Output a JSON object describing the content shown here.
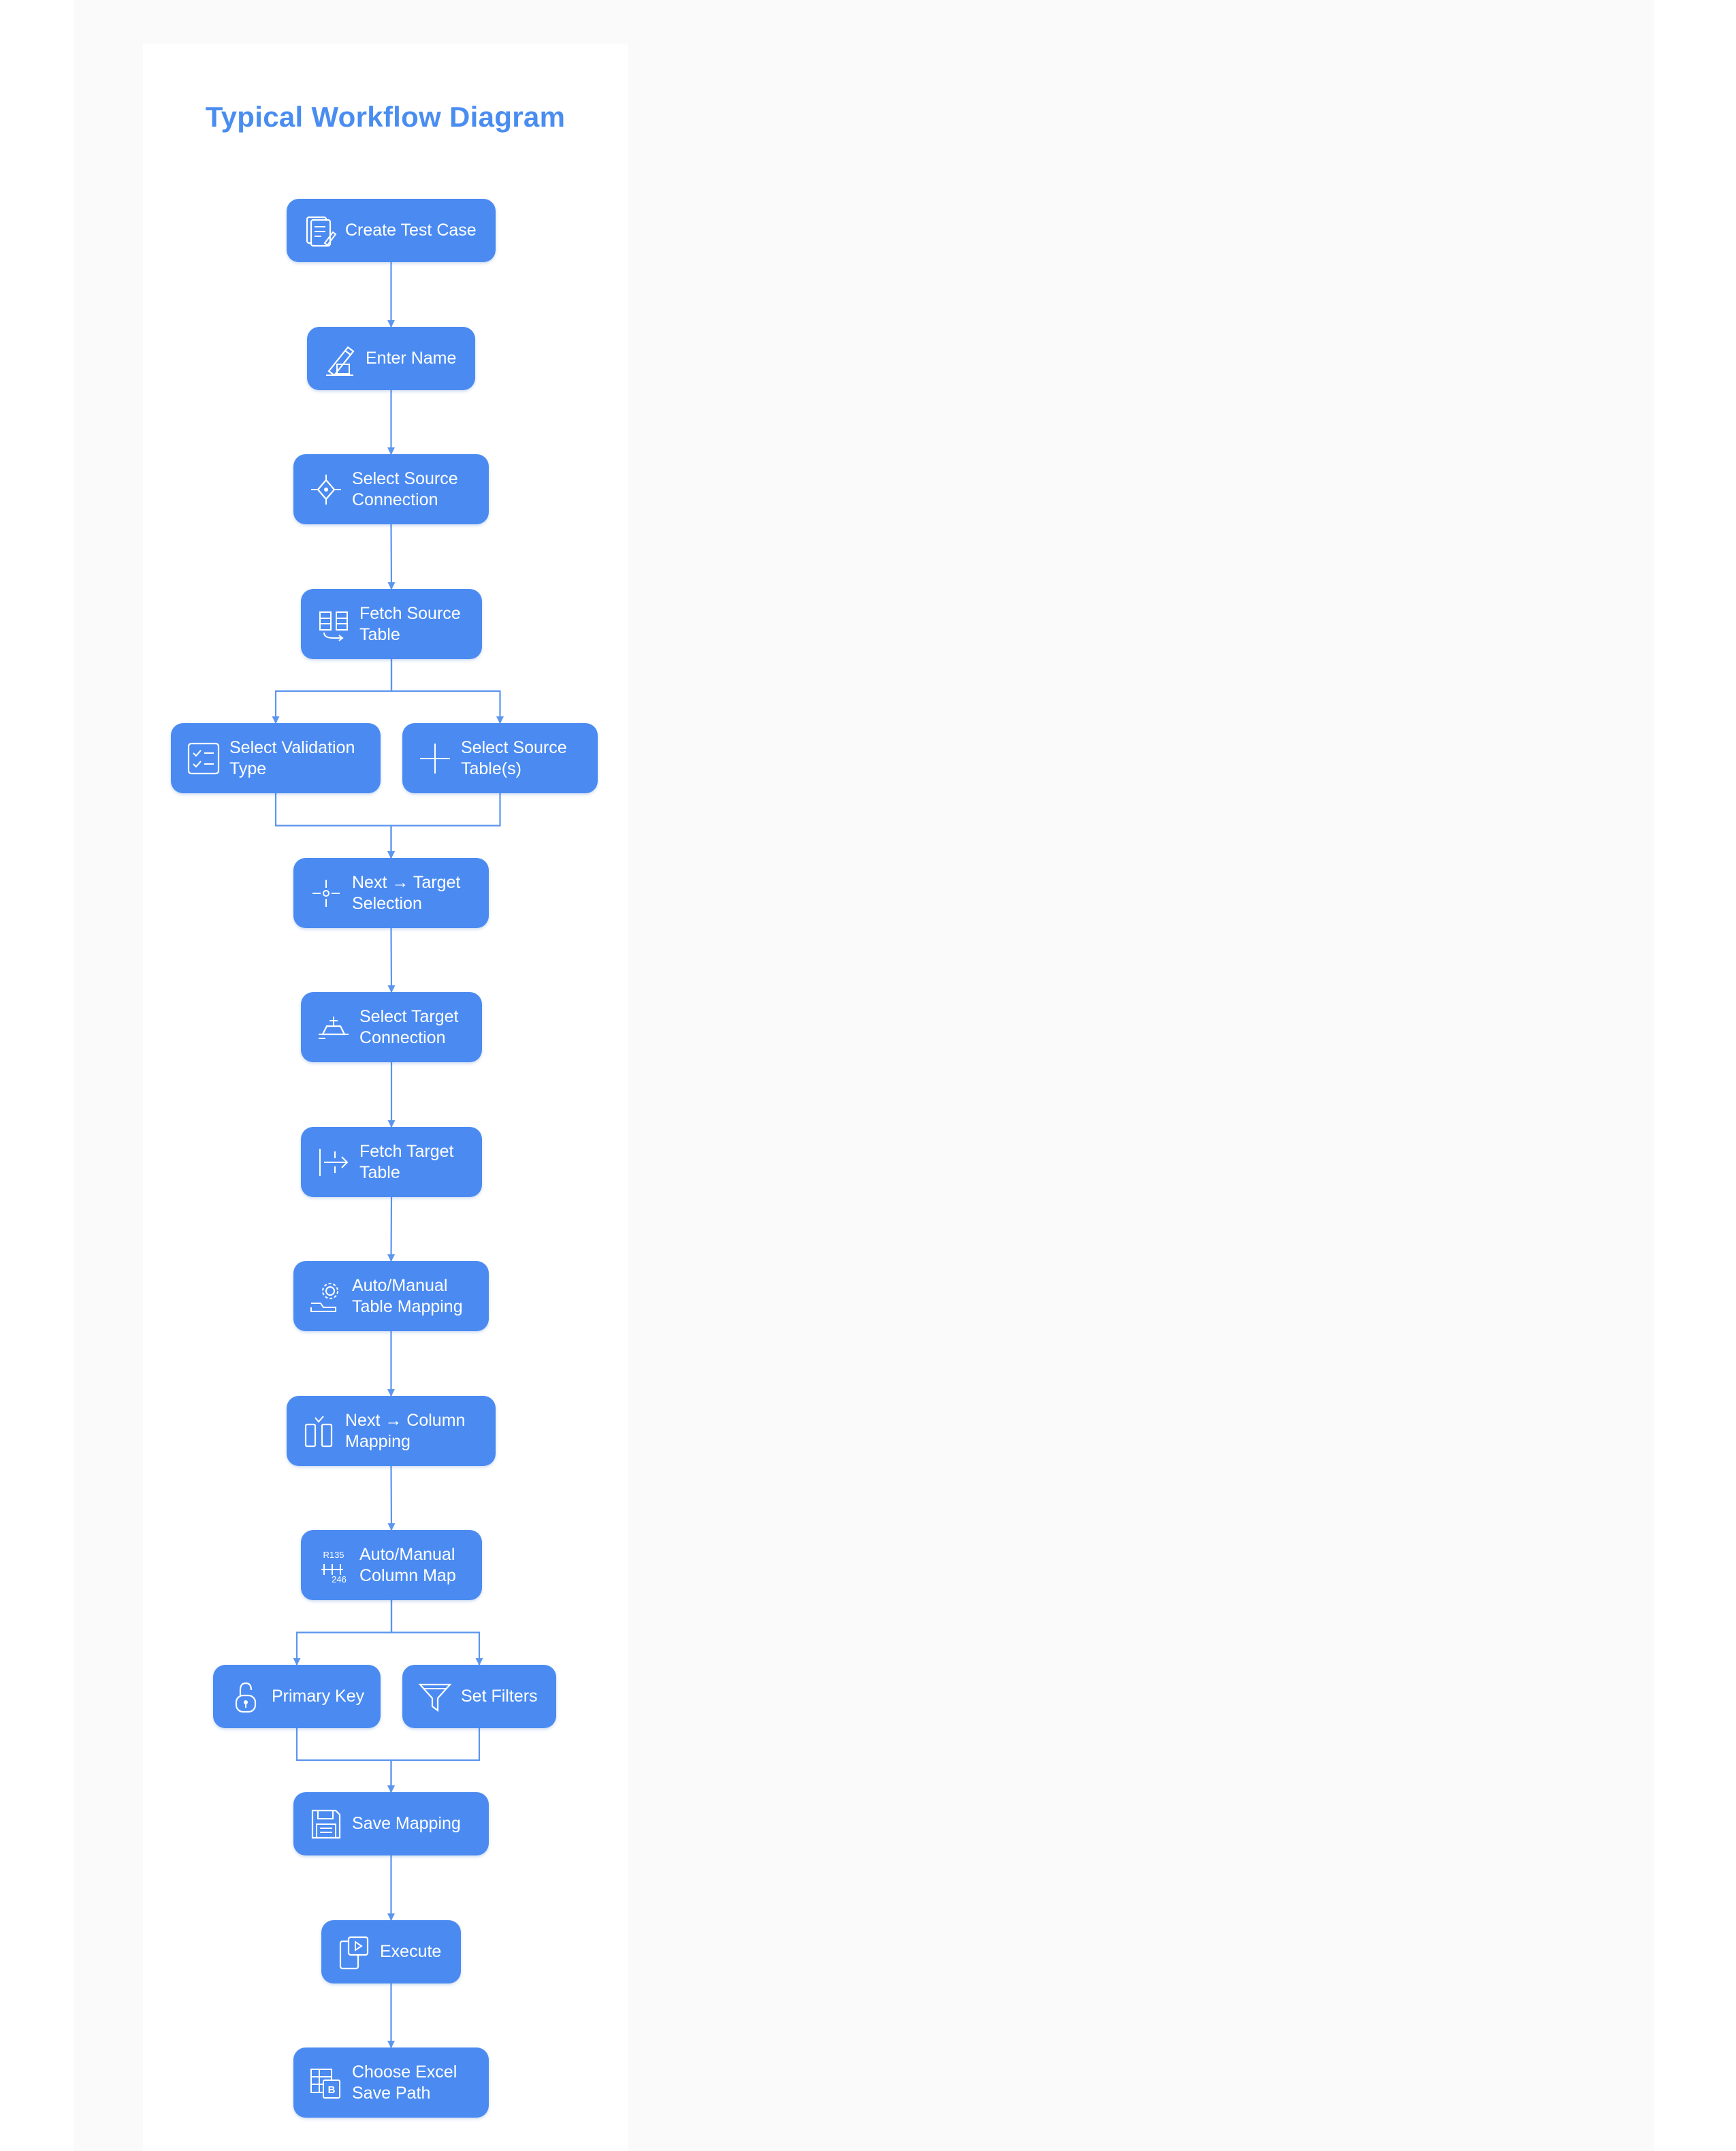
{
  "diagram": {
    "title": "Typical Workflow Diagram",
    "colors": {
      "node_fill": "#4b8bf1",
      "connector": "#5b95ee",
      "title": "#4a8df0",
      "text": "#ffffff"
    },
    "nodes": [
      {
        "id": "create_test_case",
        "label": "Create Test Case",
        "icon": "test-case-icon"
      },
      {
        "id": "enter_name",
        "label": "Enter Name",
        "icon": "pen-icon"
      },
      {
        "id": "select_source_connection",
        "label": "Select Source Connection",
        "icon": "connection-icon"
      },
      {
        "id": "fetch_source_table",
        "label": "Fetch Source Table",
        "icon": "table-fetch-icon"
      },
      {
        "id": "select_validation_type",
        "label": "Select Validation Type",
        "icon": "checklist-icon"
      },
      {
        "id": "select_source_tables",
        "label": "Select Source Table(s)",
        "icon": "plus-icon"
      },
      {
        "id": "next_target_selection",
        "label": "Next → Target Selection",
        "icon": "crosshair-icon"
      },
      {
        "id": "select_target_connection",
        "label": "Select Target Connection",
        "icon": "target-connection-icon"
      },
      {
        "id": "fetch_target_table",
        "label": "Fetch Target Table",
        "icon": "arrow-right-icon"
      },
      {
        "id": "auto_manual_table_mapping",
        "label": "Auto/Manual Table Mapping",
        "icon": "gear-icon"
      },
      {
        "id": "next_column_mapping",
        "label": "Next → Column Mapping",
        "icon": "columns-icon"
      },
      {
        "id": "auto_manual_column_map",
        "label": "Auto/Manual Column Map",
        "icon": "gear-shift-icon",
        "icon_text": [
          "R135",
          "246"
        ]
      },
      {
        "id": "primary_key",
        "label": "Primary Key",
        "icon": "lock-icon"
      },
      {
        "id": "set_filters",
        "label": "Set Filters",
        "icon": "funnel-icon"
      },
      {
        "id": "save_mapping",
        "label": "Save Mapping",
        "icon": "save-icon"
      },
      {
        "id": "execute",
        "label": "Execute",
        "icon": "play-icon"
      },
      {
        "id": "choose_excel_save_path",
        "label": "Choose Excel Save Path",
        "icon": "excel-icon"
      }
    ],
    "edges": [
      [
        "create_test_case",
        "enter_name"
      ],
      [
        "enter_name",
        "select_source_connection"
      ],
      [
        "select_source_connection",
        "fetch_source_table"
      ],
      [
        "fetch_source_table",
        "select_validation_type"
      ],
      [
        "fetch_source_table",
        "select_source_tables"
      ],
      [
        "select_validation_type",
        "next_target_selection"
      ],
      [
        "select_source_tables",
        "next_target_selection"
      ],
      [
        "next_target_selection",
        "select_target_connection"
      ],
      [
        "select_target_connection",
        "fetch_target_table"
      ],
      [
        "fetch_target_table",
        "auto_manual_table_mapping"
      ],
      [
        "auto_manual_table_mapping",
        "next_column_mapping"
      ],
      [
        "next_column_mapping",
        "auto_manual_column_map"
      ],
      [
        "auto_manual_column_map",
        "primary_key"
      ],
      [
        "auto_manual_column_map",
        "set_filters"
      ],
      [
        "primary_key",
        "save_mapping"
      ],
      [
        "set_filters",
        "save_mapping"
      ],
      [
        "save_mapping",
        "execute"
      ],
      [
        "execute",
        "choose_excel_save_path"
      ]
    ]
  }
}
